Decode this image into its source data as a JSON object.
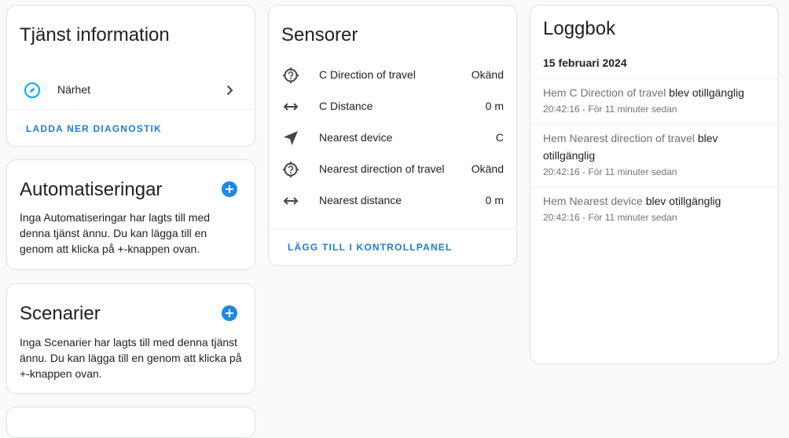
{
  "service_info": {
    "title": "Tjänst information",
    "item_label": "Närhet",
    "download_label": "LADDA NER DIAGNOSTIK"
  },
  "automations": {
    "title": "Automatiseringar",
    "description": "Inga Automatiseringar har lagts till med denna tjänst ännu. Du kan lägga till en genom att klicka på +-knappen ovan."
  },
  "scenes": {
    "title": "Scenarier",
    "description": "Inga Scenarier har lagts till med denna tjänst ännu. Du kan lägga till en genom att klicka på +-knappen ovan."
  },
  "sensors": {
    "title": "Sensorer",
    "items": [
      {
        "icon": "help-circle-icon",
        "name": "C Direction of travel",
        "value": "Okänd"
      },
      {
        "icon": "arrow-left-right-icon",
        "name": "C Distance",
        "value": "0 m"
      },
      {
        "icon": "navigation-icon",
        "name": "Nearest device",
        "value": "C"
      },
      {
        "icon": "help-circle-icon",
        "name": "Nearest direction of travel",
        "value": "Okänd"
      },
      {
        "icon": "arrow-left-right-icon",
        "name": "Nearest distance",
        "value": "0 m"
      }
    ],
    "add_label": "LÄGG TILL I KONTROLLPANEL"
  },
  "logbook": {
    "title": "Loggbok",
    "date": "15 februari 2024",
    "entries": [
      {
        "entity": "Hem C Direction of travel",
        "action": "blev otillgänglig",
        "time": "20:42:16 - För 11 minuter sedan"
      },
      {
        "entity": "Hem Nearest direction of travel",
        "action": "blev otillgänglig",
        "time": "20:42:16 - För 11 minuter sedan"
      },
      {
        "entity": "Hem Nearest device",
        "action": "blev otillgänglig",
        "time": "20:42:16 - För 11 minuter sedan"
      }
    ]
  },
  "colors": {
    "accent": "#1e7cd8",
    "add_button": "#1e88e5",
    "compass_icon": "#03a9f4",
    "icon_gray": "#44464b",
    "muted_text": "#727272"
  }
}
